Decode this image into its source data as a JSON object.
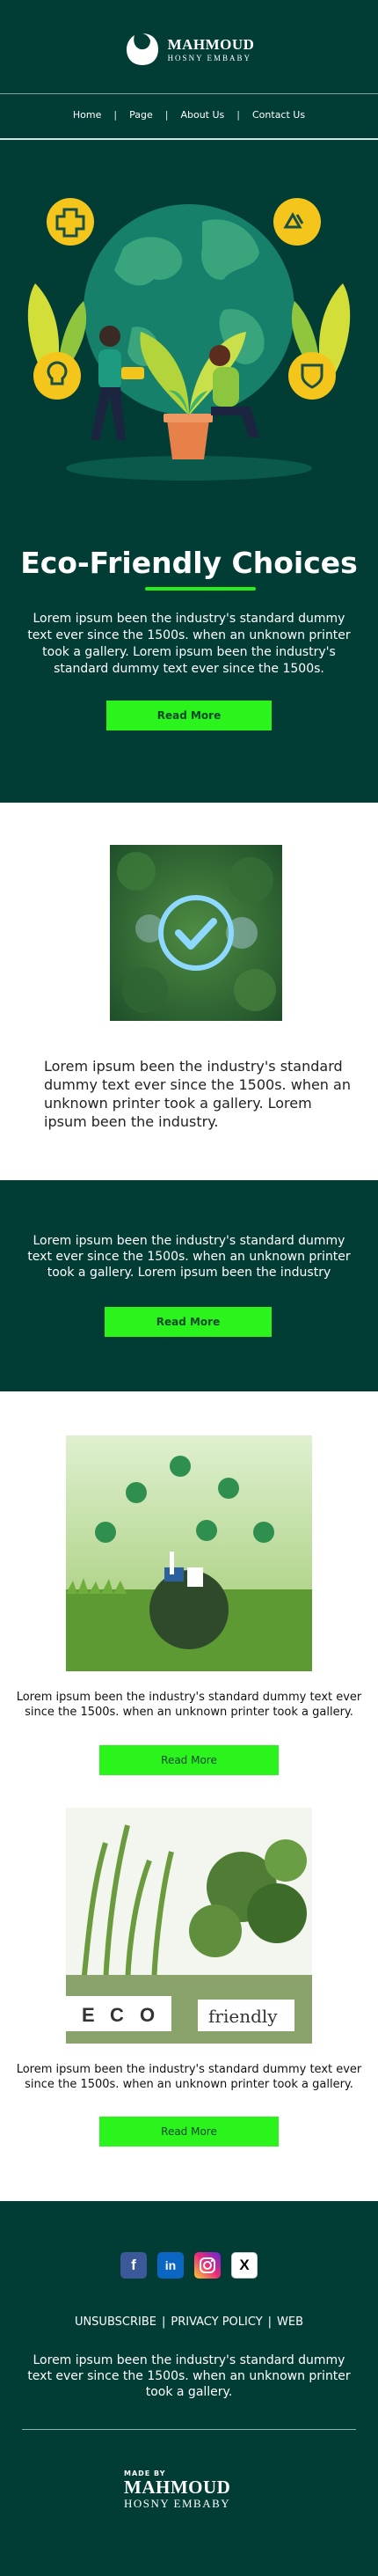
{
  "brand": {
    "name": "MAHMOUD",
    "subtitle": "HOSNY EMBABY"
  },
  "nav": {
    "items": [
      {
        "label": "Home"
      },
      {
        "label": "Page"
      },
      {
        "label": "About Us"
      },
      {
        "label": "Contact Us"
      }
    ],
    "separator": "|"
  },
  "hero": {
    "title": "Eco-Friendly Choices",
    "text": "Lorem ipsum been the industry's standard dummy text ever since the 1500s. when an unknown printer took a gallery. Lorem ipsum been the industry's standard dummy text ever since the 1500s.",
    "button": "Read More"
  },
  "check_section": {
    "text": "Lorem ipsum been the industry's standard dummy text ever since the 1500s. when an unknown printer took a gallery. Lorem ipsum been the industry."
  },
  "band": {
    "text": "Lorem ipsum been the industry's standard dummy text ever since the 1500s. when an unknown printer took a gallery. Lorem ipsum been the industry",
    "button": "Read More"
  },
  "feature1": {
    "text": "Lorem ipsum been the industry's standard dummy text ever since the 1500s. when an unknown printer took a gallery.",
    "button": "Read More"
  },
  "feature2": {
    "text": "Lorem ipsum been the industry's standard dummy text ever since the 1500s. when an unknown printer took a gallery.",
    "button": "Read More",
    "tiles": [
      "E",
      "C",
      "O"
    ],
    "sign_text": "friendly"
  },
  "footer": {
    "social_labels": {
      "facebook": "f",
      "linkedin": "in",
      "x": "X"
    },
    "links": [
      {
        "label": "UNSUBSCRIBE"
      },
      {
        "label": "PRIVACY POLICY"
      },
      {
        "label": "WEB"
      }
    ],
    "separator": "|",
    "text": "Lorem ipsum been the industry's standard dummy text ever since the 1500s. when an unknown printer took a gallery.",
    "made_by": "MADE BY",
    "made_name": "MAHMOUD",
    "made_sub": "HOSNY EMBABY"
  },
  "colors": {
    "background_dark": "#023d35",
    "accent_green": "#2bf31c",
    "button_text": "#0d4a2a"
  }
}
